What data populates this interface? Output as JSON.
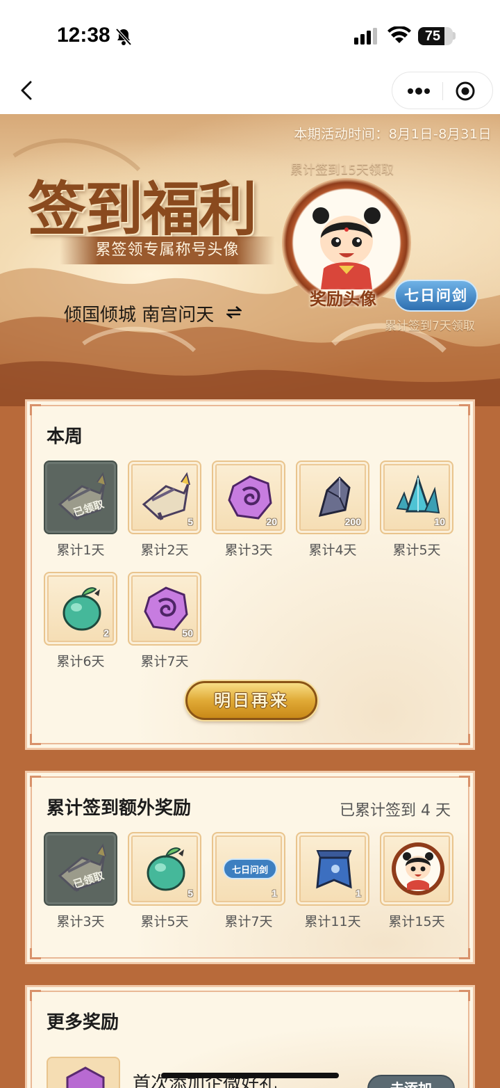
{
  "status_bar": {
    "time": "12:38",
    "battery": "75",
    "battery_level": 0.75
  },
  "nav": {
    "back_icon": "chevron-left-icon",
    "more_icon": "more-dots-icon",
    "close_icon": "target-icon"
  },
  "hero": {
    "activity_time": "本期活动时间：8月1日-8月31日",
    "title": "签到福利",
    "subtitle": "累签领专属称号头像",
    "current_title": "倾国倾城 南宫问天",
    "avatar_note": "累计签到15天领取",
    "avatar_caption": "奖励头像",
    "badge_label": "七日问剑",
    "badge_note": "累计签到7天领取"
  },
  "weekly": {
    "title": "本周",
    "claimed_text": "已领取",
    "items": [
      {
        "label": "累计1天",
        "count": "",
        "icon": "scroll-icon",
        "claimed": true
      },
      {
        "label": "累计2天",
        "count": "5",
        "icon": "scroll-icon",
        "claimed": false
      },
      {
        "label": "累计3天",
        "count": "20",
        "icon": "purple-token-icon",
        "claimed": false
      },
      {
        "label": "累计4天",
        "count": "200",
        "icon": "dark-crystal-icon",
        "claimed": false
      },
      {
        "label": "累计5天",
        "count": "10",
        "icon": "blue-crystal-icon",
        "claimed": false
      },
      {
        "label": "累计6天",
        "count": "2",
        "icon": "green-fruit-icon",
        "claimed": false
      },
      {
        "label": "累计7天",
        "count": "50",
        "icon": "purple-token-icon",
        "claimed": false
      }
    ],
    "button": "明日再来"
  },
  "cumulative": {
    "title": "累计签到额外奖励",
    "status": "已累计签到 4 天",
    "claimed_text": "已领取",
    "items": [
      {
        "label": "累计3天",
        "count": "",
        "icon": "scroll-icon",
        "claimed": true
      },
      {
        "label": "累计5天",
        "count": "5",
        "icon": "green-fruit-icon",
        "claimed": false
      },
      {
        "label": "累计7天",
        "count": "1",
        "icon": "title-badge-icon",
        "claimed": false,
        "badge_text": "七日问剑"
      },
      {
        "label": "累计11天",
        "count": "1",
        "icon": "blue-banner-icon",
        "claimed": false
      },
      {
        "label": "累计15天",
        "count": "",
        "icon": "avatar-frame-icon",
        "claimed": false
      }
    ]
  },
  "more": {
    "title": "更多奖励",
    "item_text": "首次添加企微好礼",
    "item_button": "去添加"
  }
}
